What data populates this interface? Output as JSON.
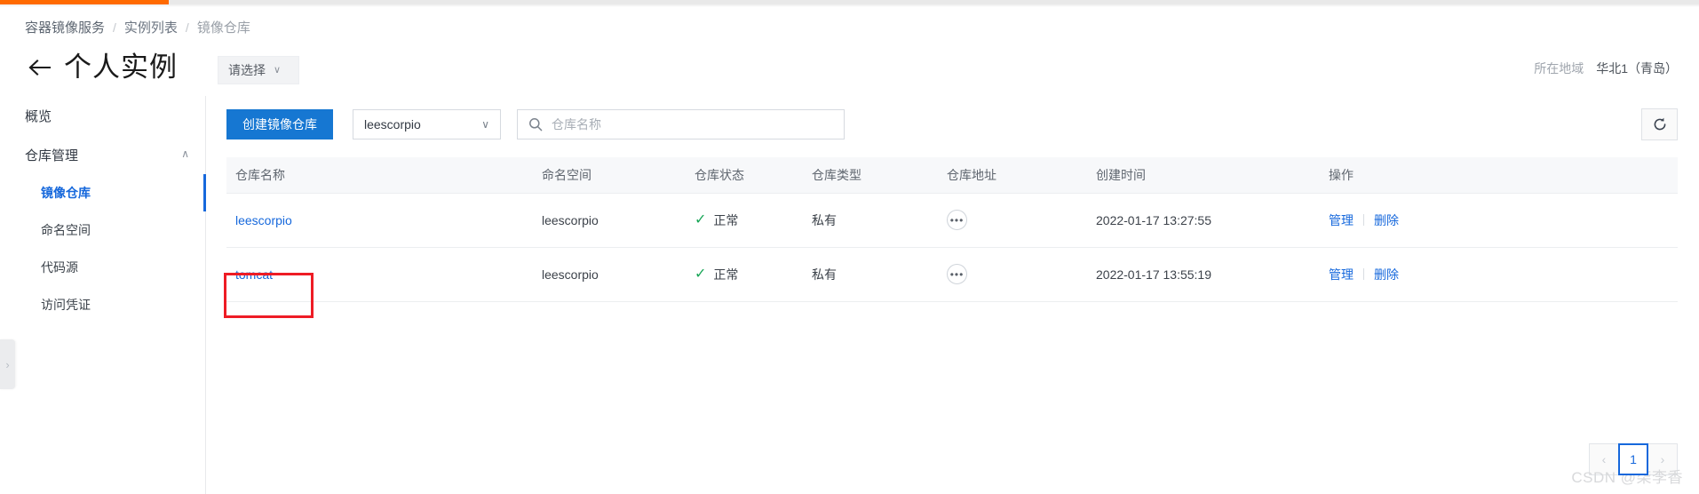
{
  "topbar": {
    "progress_percent": 10,
    "accent_color": "#ff6a00"
  },
  "breadcrumb": {
    "items": [
      {
        "label": "容器镜像服务"
      },
      {
        "label": "实例列表"
      },
      {
        "label": "镜像仓库"
      }
    ],
    "separator": "/"
  },
  "header": {
    "back_icon": "arrow-left-icon",
    "title": "个人实例",
    "instance_select": {
      "label": "请选择",
      "caret": "∨"
    },
    "region": {
      "label": "所在地域",
      "value": "华北1（青岛）"
    }
  },
  "sidebar": {
    "items": [
      {
        "label": "概览",
        "level": 0,
        "active": false
      },
      {
        "label": "仓库管理",
        "level": 0,
        "active": false,
        "expanded": true,
        "chevron": "∧"
      },
      {
        "label": "镜像仓库",
        "level": 1,
        "active": true
      },
      {
        "label": "命名空间",
        "level": 1,
        "active": false
      },
      {
        "label": "代码源",
        "level": 1,
        "active": false
      },
      {
        "label": "访问凭证",
        "level": 1,
        "active": false
      }
    ],
    "collapse_handle": {
      "icon": "chevron-right-icon",
      "glyph": "›"
    }
  },
  "toolbar": {
    "create_button": "创建镜像仓库",
    "namespace_select": {
      "value": "leescorpio",
      "caret": "∨"
    },
    "search": {
      "value": "",
      "placeholder": "仓库名称",
      "icon": "search-icon"
    },
    "refresh_button": {
      "icon": "refresh-icon",
      "label": ""
    }
  },
  "table": {
    "columns": [
      {
        "key": "name",
        "label": "仓库名称"
      },
      {
        "key": "ns",
        "label": "命名空间"
      },
      {
        "key": "state",
        "label": "仓库状态"
      },
      {
        "key": "type",
        "label": "仓库类型"
      },
      {
        "key": "addr",
        "label": "仓库地址"
      },
      {
        "key": "time",
        "label": "创建时间"
      },
      {
        "key": "ops",
        "label": "操作"
      }
    ],
    "rows": [
      {
        "name": "leescorpio",
        "ns": "leescorpio",
        "state": "正常",
        "state_icon": "check-icon",
        "type": "私有",
        "addr_icon": "ellipsis-icon",
        "addr_glyph": "•••",
        "time": "2022-01-17 13:27:55",
        "op_manage": "管理",
        "op_delete": "删除",
        "highlighted": false
      },
      {
        "name": "tomcat",
        "ns": "leescorpio",
        "state": "正常",
        "state_icon": "check-icon",
        "type": "私有",
        "addr_icon": "ellipsis-icon",
        "addr_glyph": "•••",
        "time": "2022-01-17 13:55:19",
        "op_manage": "管理",
        "op_delete": "删除",
        "highlighted": true
      }
    ]
  },
  "pagination": {
    "prev": "‹",
    "next": "›",
    "current_page": "1",
    "pages": [
      "1"
    ]
  },
  "annotation": {
    "color": "#ee1c25",
    "target": "tomcat"
  },
  "watermark": {
    "text": "CSDN @柒李香"
  },
  "colors": {
    "accent_blue": "#1668dc",
    "button_blue": "#1677d2",
    "success_green": "#19a657",
    "orange": "#ff6a00"
  }
}
